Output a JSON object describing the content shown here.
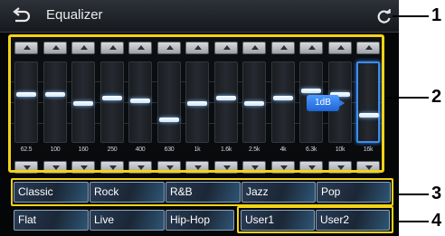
{
  "header": {
    "title": "Equalizer"
  },
  "equalizer": {
    "bands": [
      {
        "freq": "62.5",
        "level": 0.6
      },
      {
        "freq": "100",
        "level": 0.6
      },
      {
        "freq": "160",
        "level": 0.48
      },
      {
        "freq": "250",
        "level": 0.56
      },
      {
        "freq": "400",
        "level": 0.52
      },
      {
        "freq": "630",
        "level": 0.26
      },
      {
        "freq": "1k",
        "level": 0.48
      },
      {
        "freq": "1.6k",
        "level": 0.56
      },
      {
        "freq": "2.5k",
        "level": 0.48
      },
      {
        "freq": "4k",
        "level": 0.56
      },
      {
        "freq": "6.3k",
        "level": 0.66
      },
      {
        "freq": "10k",
        "level": 0.6
      },
      {
        "freq": "16k",
        "level": 0.33,
        "selected": true
      }
    ],
    "tooltip": "1dB"
  },
  "presets": {
    "row1": [
      "Classic",
      "Rock",
      "R&B",
      "Jazz",
      "Pop"
    ],
    "row2": [
      "Flat",
      "Live",
      "Hip-Hop"
    ],
    "user": [
      "User1",
      "User2"
    ]
  },
  "callouts": [
    "1",
    "2",
    "3",
    "4"
  ],
  "colors": {
    "highlight": "#f2d316",
    "accent": "#3c8df0"
  }
}
